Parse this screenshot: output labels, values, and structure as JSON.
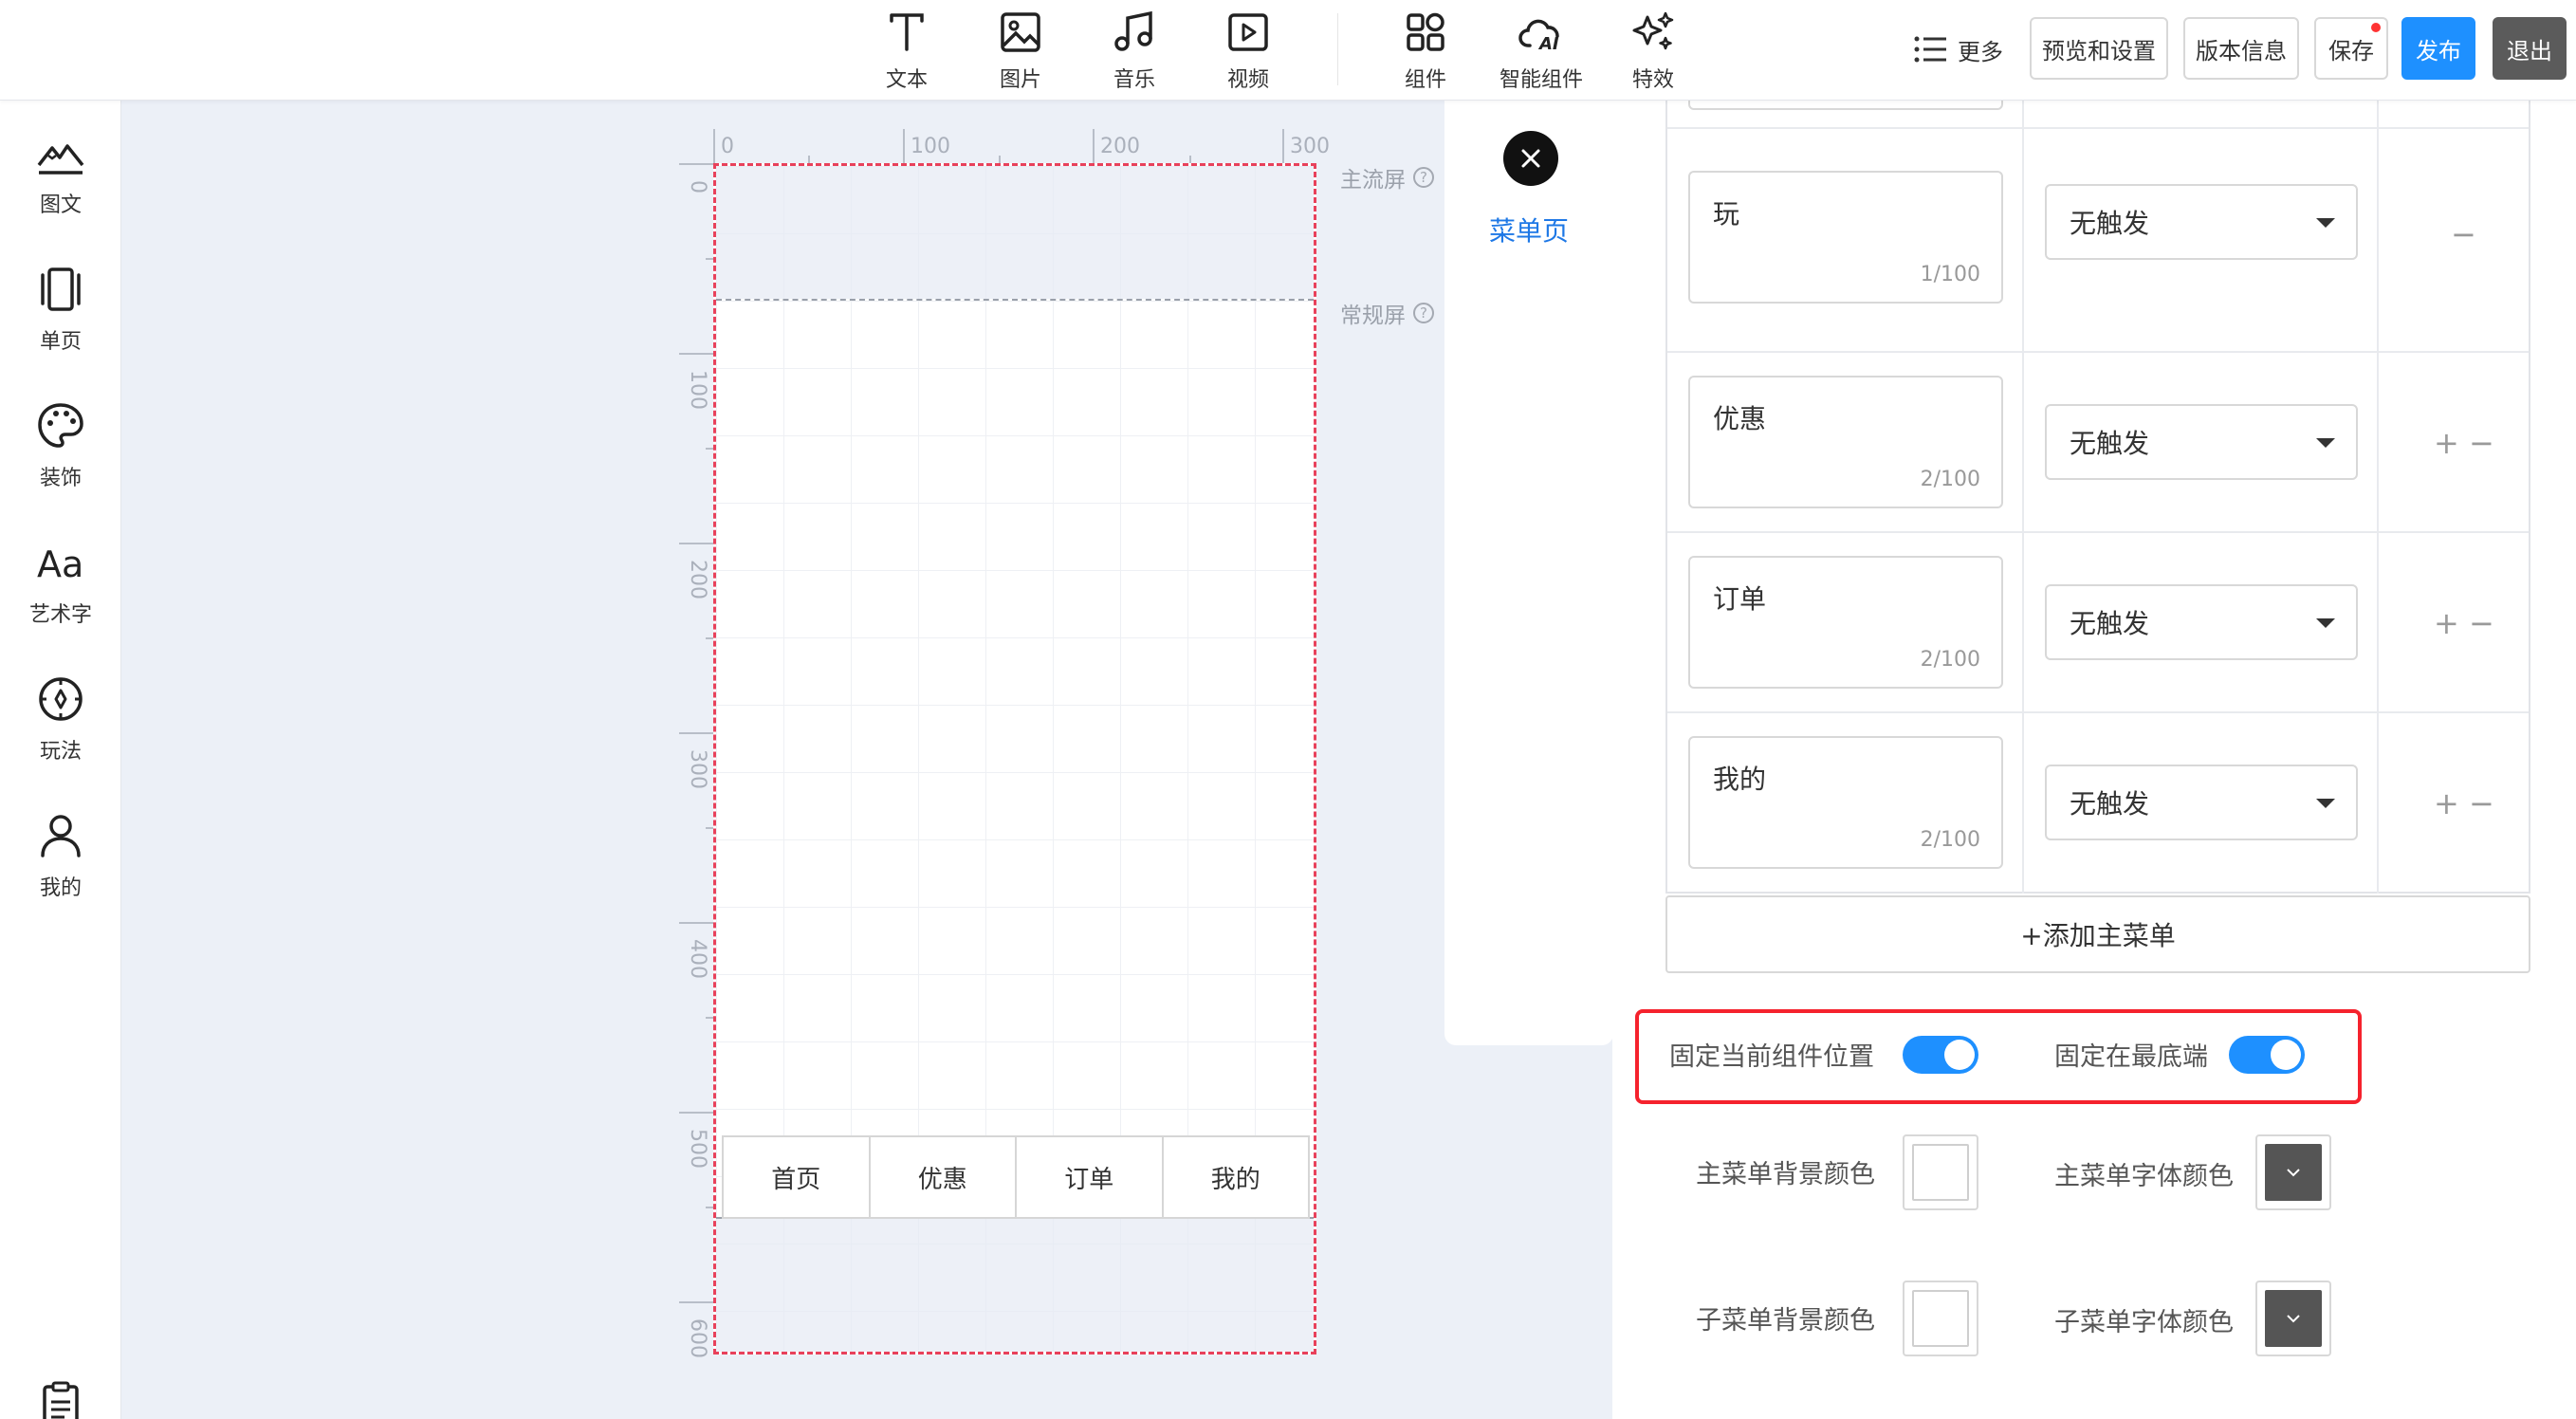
{
  "toolbar": {
    "tools": [
      {
        "label": "文本",
        "icon": "text-icon"
      },
      {
        "label": "图片",
        "icon": "image-icon"
      },
      {
        "label": "音乐",
        "icon": "music-icon"
      },
      {
        "label": "视频",
        "icon": "video-icon"
      },
      {
        "label": "组件",
        "icon": "components-icon"
      },
      {
        "label": "智能组件",
        "icon": "ai-cloud-icon"
      },
      {
        "label": "特效",
        "icon": "sparkle-icon"
      }
    ],
    "more_label": "更多",
    "preview_label": "预览和设置",
    "version_label": "版本信息",
    "save_label": "保存",
    "publish_label": "发布",
    "exit_label": "退出",
    "accent_color": "#1e90ff"
  },
  "sidebar": {
    "items": [
      {
        "label": "图文",
        "icon": "mountain-icon"
      },
      {
        "label": "单页",
        "icon": "page-icon"
      },
      {
        "label": "装饰",
        "icon": "palette-icon"
      },
      {
        "label": "艺术字",
        "icon": "art-text-icon"
      },
      {
        "label": "玩法",
        "icon": "compass-icon"
      },
      {
        "label": "我的",
        "icon": "user-icon"
      }
    ],
    "bottom_icon": "clipboard-icon"
  },
  "ruler": {
    "horizontal": [
      "0",
      "100",
      "200",
      "300"
    ],
    "vertical": [
      "0",
      "100",
      "200",
      "300",
      "400",
      "500",
      "600"
    ]
  },
  "canvas": {
    "main_screen_label": "主流屏",
    "regular_screen_label": "常规屏",
    "menu_items": [
      "首页",
      "优惠",
      "订单",
      "我的"
    ]
  },
  "center_panel": {
    "title": "菜单页"
  },
  "menu_table": {
    "rows": [
      {
        "name": "玩",
        "count": "1/100",
        "trigger": "无触发",
        "ops": "−"
      },
      {
        "name": "优惠",
        "count": "2/100",
        "trigger": "无触发",
        "ops": "+ −"
      },
      {
        "name": "订单",
        "count": "2/100",
        "trigger": "无触发",
        "ops": "+ −"
      },
      {
        "name": "我的",
        "count": "2/100",
        "trigger": "无触发",
        "ops": "+ −"
      }
    ],
    "add_label": "+添加主菜单"
  },
  "settings": {
    "fix_position_label": "固定当前组件位置",
    "fix_position_on": true,
    "fix_bottom_label": "固定在最底端",
    "fix_bottom_on": true,
    "main_bg_label": "主菜单背景颜色",
    "main_font_label": "主菜单字体颜色",
    "sub_bg_label": "子菜单背景颜色",
    "sub_font_label": "子菜单字体颜色",
    "highlight_color": "#f5222d"
  }
}
